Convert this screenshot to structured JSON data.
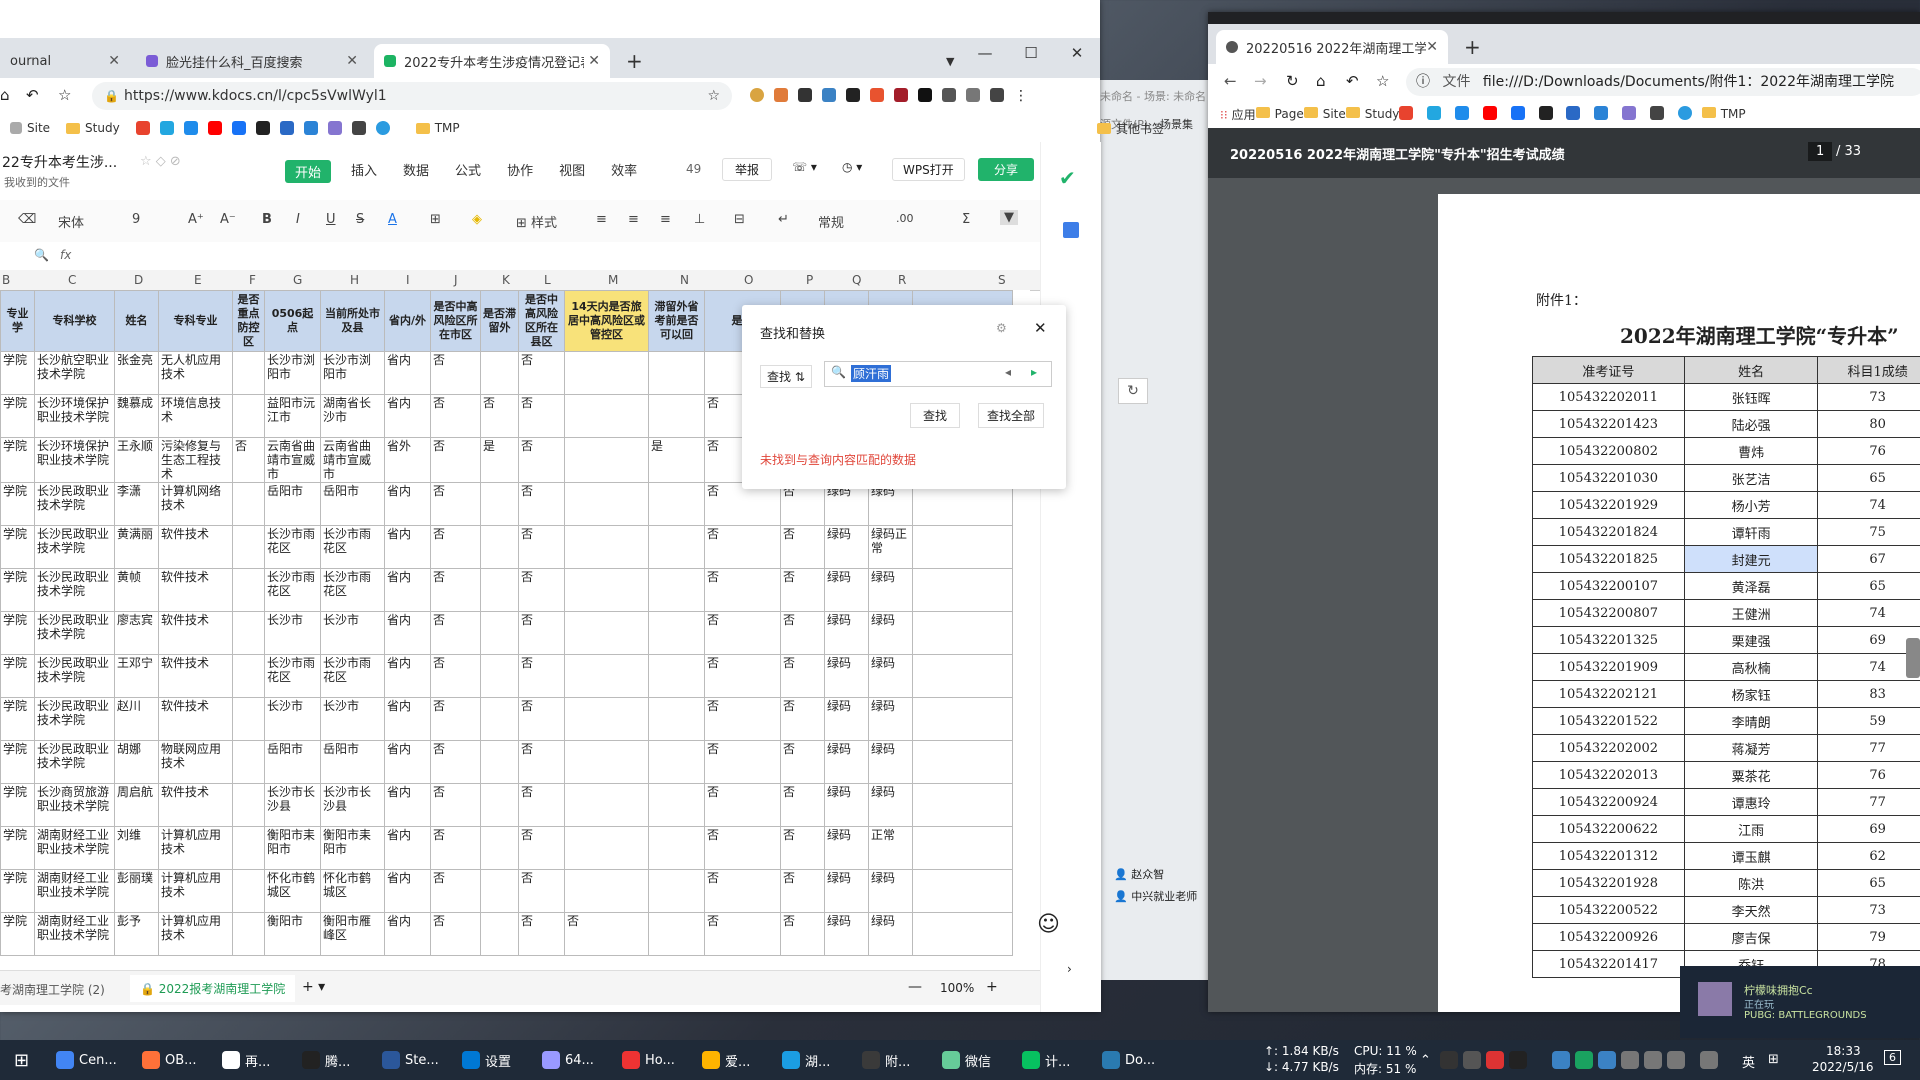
{
  "left_browser": {
    "tabs": [
      {
        "label": "ournal"
      },
      {
        "label": "脸光挂什么科_百度搜索"
      },
      {
        "label": "2022专升本考生涉疫情况登记表",
        "active": true
      }
    ],
    "url": "https://www.kdocs.cn/l/cpc5sVwlWyl1",
    "bookmarks": [
      "Site",
      "Study",
      "TMP",
      "其他书签"
    ],
    "doc_title": "22专升本考生涉...",
    "doc_subtitle": "我收到的文件",
    "menu": [
      "开始",
      "插入",
      "数据",
      "公式",
      "协作",
      "视图",
      "效率"
    ],
    "menu_badge": "49",
    "report_label": "举报",
    "wps_open_label": "WPS打开",
    "share_label": "分享",
    "toolbar": {
      "font": "宋体",
      "size": "9",
      "style_label": "样式",
      "format": "常规"
    },
    "fx_label": "fx",
    "columns": [
      "B",
      "C",
      "D",
      "E",
      "F",
      "G",
      "H",
      "I",
      "J",
      "K",
      "L",
      "M",
      "N",
      "O",
      "P",
      "Q",
      "R",
      "S"
    ],
    "headers": [
      "专业\n学",
      "专科学校",
      "姓名",
      "专科专业",
      "是否重点防控区",
      "0506起点",
      "当前所处市及县",
      "省内/外",
      "是否中高风险区所在市区",
      "是否滞留外",
      "是否中高风险区所在县区",
      "14天内是否旅居中高风险区或管控区",
      "滞留外省考前是否可以回",
      "是否",
      "",
      "",
      "",
      ""
    ],
    "rows": [
      [
        "学院",
        "长沙航空职业技术学院",
        "张金亮",
        "无人机应用技术",
        "",
        "长沙市浏阳市",
        "长沙市浏阳市",
        "省内",
        "否",
        "",
        "否",
        "",
        "",
        "",
        "",
        "",
        "",
        ""
      ],
      [
        "学院",
        "长沙环境保护职业技术学院",
        "魏慕成",
        "环境信息技术",
        "",
        "益阳市沅江市",
        "湖南省长沙市",
        "省内",
        "否",
        "否",
        "否",
        "",
        "",
        "否",
        "",
        "",
        "",
        ""
      ],
      [
        "学院",
        "长沙环境保护职业技术学院",
        "王永顺",
        "污染修复与生态工程技术",
        "否",
        "云南省曲靖市宣威市",
        "云南省曲靖市宣威市",
        "省外",
        "否",
        "是",
        "否",
        "",
        "是",
        "否",
        "",
        "",
        "",
        ""
      ],
      [
        "学院",
        "长沙民政职业技术学院",
        "李潇",
        "计算机网络技术",
        "",
        "岳阳市",
        "岳阳市",
        "省内",
        "否",
        "",
        "否",
        "",
        "",
        "否",
        "否",
        "绿码",
        "绿码",
        ""
      ],
      [
        "学院",
        "长沙民政职业技术学院",
        "黄满丽",
        "软件技术",
        "",
        "长沙市雨花区",
        "长沙市雨花区",
        "省内",
        "否",
        "",
        "否",
        "",
        "",
        "否",
        "否",
        "绿码",
        "绿码正常",
        ""
      ],
      [
        "学院",
        "长沙民政职业技术学院",
        "黄帧",
        "软件技术",
        "",
        "长沙市雨花区",
        "长沙市雨花区",
        "省内",
        "否",
        "",
        "否",
        "",
        "",
        "否",
        "否",
        "绿码",
        "绿码",
        ""
      ],
      [
        "学院",
        "长沙民政职业技术学院",
        "廖志宾",
        "软件技术",
        "",
        "长沙市",
        "长沙市",
        "省内",
        "否",
        "",
        "否",
        "",
        "",
        "否",
        "否",
        "绿码",
        "绿码",
        ""
      ],
      [
        "学院",
        "长沙民政职业技术学院",
        "王邓宁",
        "软件技术",
        "",
        "长沙市雨花区",
        "长沙市雨花区",
        "省内",
        "否",
        "",
        "否",
        "",
        "",
        "否",
        "否",
        "绿码",
        "绿码",
        ""
      ],
      [
        "学院",
        "长沙民政职业技术学院",
        "赵川",
        "软件技术",
        "",
        "长沙市",
        "长沙市",
        "省内",
        "否",
        "",
        "否",
        "",
        "",
        "否",
        "否",
        "绿码",
        "绿码",
        ""
      ],
      [
        "学院",
        "长沙民政职业技术学院",
        "胡娜",
        "物联网应用技术",
        "",
        "岳阳市",
        "岳阳市",
        "省内",
        "否",
        "",
        "否",
        "",
        "",
        "否",
        "否",
        "绿码",
        "绿码",
        ""
      ],
      [
        "学院",
        "长沙商贸旅游职业技术学院",
        "周启航",
        "软件技术",
        "",
        "长沙市长沙县",
        "长沙市长沙县",
        "省内",
        "否",
        "",
        "否",
        "",
        "",
        "否",
        "否",
        "绿码",
        "绿码",
        ""
      ],
      [
        "学院",
        "湖南财经工业职业技术学院",
        "刘维",
        "计算机应用技术",
        "",
        "衡阳市耒阳市",
        "衡阳市耒阳市",
        "省内",
        "否",
        "",
        "否",
        "",
        "",
        "否",
        "否",
        "绿码",
        "正常",
        ""
      ],
      [
        "学院",
        "湖南财经工业职业技术学院",
        "彭丽璞",
        "计算机应用技术",
        "",
        "怀化市鹤城区",
        "怀化市鹤城区",
        "省内",
        "否",
        "",
        "否",
        "",
        "",
        "否",
        "否",
        "绿码",
        "绿码",
        ""
      ],
      [
        "学院",
        "湖南财经工业职业技术学院",
        "彭予",
        "计算机应用技术",
        "",
        "衡阳市",
        "衡阳市雁峰区",
        "省内",
        "否",
        "",
        "否",
        "否",
        "",
        "否",
        "否",
        "绿码",
        "绿码",
        ""
      ]
    ],
    "sheet_tabs": [
      "考湖南理工学院 (2)",
      "2022报考湖南理工学院"
    ],
    "zoom": "100%",
    "find_dialog": {
      "title": "查找和替换",
      "mode_label": "查找",
      "query": "顾汗雨",
      "find_btn": "查找",
      "find_all_btn": "查找全部",
      "message": "未找到与查询内容匹配的数据"
    }
  },
  "right_browser": {
    "tab_label": "20220516 2022年湖南理工学院",
    "url_prefix": "文件",
    "url": "file:///D:/Downloads/Documents/附件1：2022年湖南理工学院",
    "bookmarks": [
      "应用",
      "Page",
      "Site",
      "Study",
      "TMP"
    ],
    "pdf_title": "20220516 2022年湖南理工学院\"专升本\"招生考试成绩",
    "page_current": "1",
    "page_total": "/ 33",
    "attach_label": "附件1：",
    "doc_heading": "2022年湖南理工学院“专升本”",
    "table_headers": [
      "准考证号",
      "姓名",
      "科目1成绩"
    ],
    "table_rows": [
      [
        "105432202011",
        "张钰晖",
        "73"
      ],
      [
        "105432201423",
        "陆必强",
        "80"
      ],
      [
        "105432200802",
        "曹炜",
        "76"
      ],
      [
        "105432201030",
        "张艺洁",
        "65"
      ],
      [
        "105432201929",
        "杨小芳",
        "74"
      ],
      [
        "105432201824",
        "谭轩雨",
        "75"
      ],
      [
        "105432201825",
        "封建元",
        "67"
      ],
      [
        "105432200107",
        "黄泽磊",
        "65"
      ],
      [
        "105432200807",
        "王健洲",
        "74"
      ],
      [
        "105432201325",
        "栗建强",
        "69"
      ],
      [
        "105432201909",
        "高秋楠",
        "74"
      ],
      [
        "105432202121",
        "杨家钰",
        "83"
      ],
      [
        "105432201522",
        "李晴朗",
        "59"
      ],
      [
        "105432202002",
        "蒋凝芳",
        "77"
      ],
      [
        "105432202013",
        "粟茶花",
        "76"
      ],
      [
        "105432200924",
        "谭惠玲",
        "77"
      ],
      [
        "105432200622",
        "江雨",
        "69"
      ],
      [
        "105432201312",
        "谭玉麒",
        "62"
      ],
      [
        "105432201928",
        "陈洪",
        "65"
      ],
      [
        "105432200522",
        "李天然",
        "73"
      ],
      [
        "105432200926",
        "廖吉保",
        "79"
      ],
      [
        "105432201417",
        "乔钰",
        "78"
      ]
    ]
  },
  "background_window": {
    "text1": "未命名 - 场景: 未命名",
    "text2": "源文件(P)",
    "text3": "场景集",
    "contact1": "赵众智",
    "contact2": "中兴就业老师"
  },
  "notification": {
    "line1": "柠檬味拥抱Cc",
    "line2": "正在玩",
    "line3": "PUBG: BATTLEGROUNDS"
  },
  "taskbar": {
    "items": [
      "Cen...",
      "OB...",
      "再...",
      "腾...",
      "Ste...",
      "设置",
      "64...",
      "Ho...",
      "爱...",
      "湖...",
      "附...",
      "微信",
      "计...",
      "Do..."
    ],
    "net_up": "↑: 1.84 KB/s",
    "net_down": "↓: 4.77 KB/s",
    "cpu": "CPU: 11 %",
    "mem": "内存: 51 %",
    "lang": "英",
    "time": "18:33",
    "date": "2022/5/16",
    "notif_count": "6"
  }
}
